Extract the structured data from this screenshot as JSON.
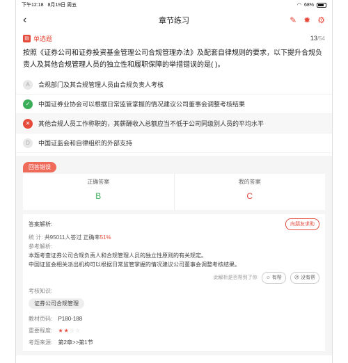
{
  "status": {
    "time": "下午12:18",
    "date": "8月19日 周五",
    "battery": "68%"
  },
  "nav": {
    "back": "‹",
    "title": "章节练习",
    "icons": [
      "edit-icon",
      "bug-icon",
      "settings-icon"
    ]
  },
  "question": {
    "type": "单选题",
    "current": "13",
    "total": "/54",
    "text": "按照《证券公司和证券投资基金管理公司合规管理办法》及配套自律规则的要求，以下提升合规负责人及其他合规管理人员的独立性和履职保障的举措错误的是(  )。",
    "options": [
      {
        "mark": "A",
        "text": "合规部门及其合规管理人员由合规负责人考核",
        "state": "normal"
      },
      {
        "mark": "✓",
        "text": "中国证券业协会可以根据日常监管掌握的情况建议公司董事会调整考核结果",
        "state": "correct"
      },
      {
        "mark": "✕",
        "text": "其他合规人员工作称职的，其薪酬收入总额应当不低于公司同级别人员的平均水平",
        "state": "wrong"
      },
      {
        "mark": "D",
        "text": "中国证监会和自律组织的外部支持",
        "state": "normal"
      }
    ]
  },
  "result": {
    "badge": "回答错误",
    "correct_label": "正确答案",
    "correct_value": "B",
    "mine_label": "我的答案",
    "mine_value": "C"
  },
  "analysis": {
    "title": "答案解析:",
    "ask_friend": "向朋友求助",
    "stats_label": "统    计:",
    "stats_text": "共95011人答过 正确率",
    "stats_rate": "51%",
    "ref_label": "参考解析:",
    "ref_line1": "本题考查证券公司合规负责人和合规管理人员的独立性原则的有关规定。",
    "ref_line2": "中国证监会相关派出机构可以根据日常监管掌握的情况建议公司董事会调整考核结果。",
    "feedback_q": "此解析是否帮到了你",
    "fb_yes": "有帮",
    "fb_no": "没有帮",
    "knowledge_label": "考核知识:",
    "knowledge_tag": "证券公司合规管理",
    "page_label": "教材页码:",
    "page_value": "P180-188",
    "importance_label": "重要程度:",
    "importance_stars": 2,
    "importance_max": 4,
    "source_label": "考题来源:",
    "source_value": "第2章>>第1节"
  }
}
